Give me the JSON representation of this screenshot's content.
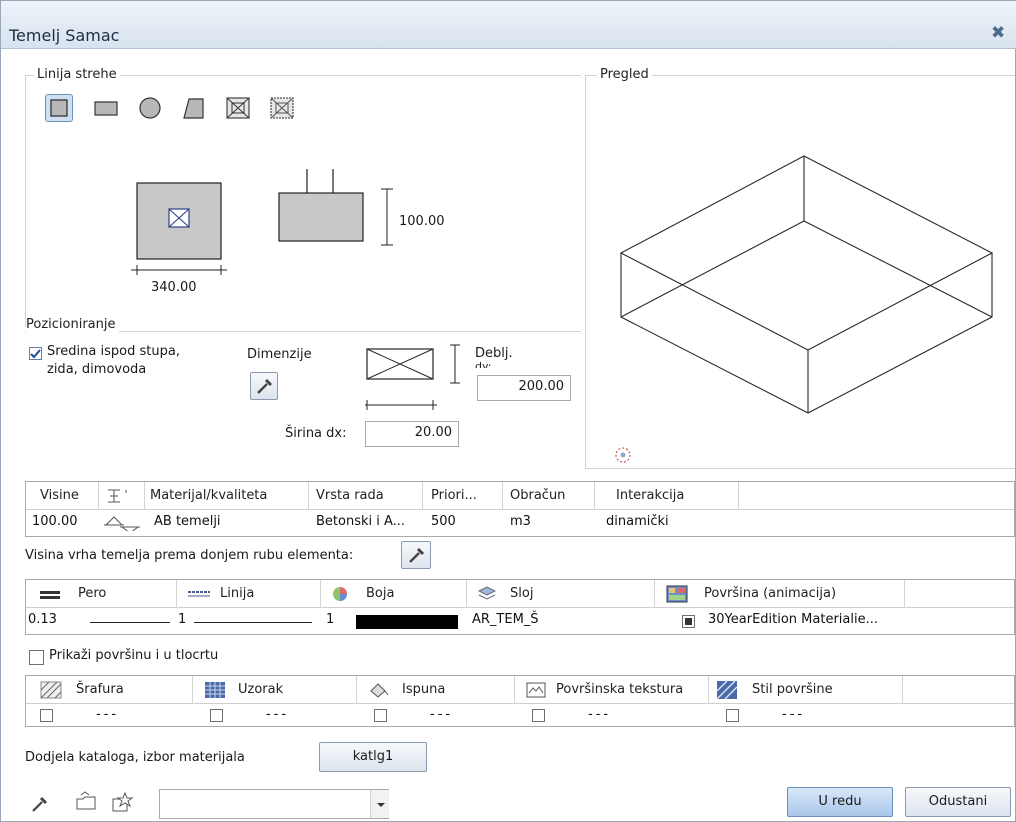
{
  "window": {
    "title": "Temelj Samac",
    "close_glyph": "✖"
  },
  "roof_line": {
    "group_label": "Linija strehe",
    "shapes": [
      "square-shape-icon",
      "rectangle-shape-icon",
      "circle-shape-icon",
      "trapezoid-shape-icon",
      "box-cross-shape-icon",
      "box-cross-dotted-shape-icon"
    ],
    "width_dim": "340.00",
    "height_dim": "100.00"
  },
  "preview": {
    "group_label": "Pregled"
  },
  "positioning": {
    "group_label": "Pozicioniranje",
    "center_checkbox_line1": "Sredina ispod stupa,",
    "center_checkbox_line2": "zida, dimovoda",
    "center_checked": true,
    "dimensions_label": "Dimenzije",
    "thickness_label_line1": "Deblj.",
    "thickness_label_line2": "dy:",
    "thickness_value": "200.00",
    "width_label": "Širina dx:",
    "width_value": "20.00"
  },
  "heights_table": {
    "headers": [
      "Visine",
      "",
      "Materijal/kvaliteta",
      "Vrsta rada",
      "Priori...",
      "Obračun",
      "Interakcija"
    ],
    "row": {
      "visine": "100.00",
      "material": "AB temelji",
      "work_type": "Betonski i A...",
      "priority": "500",
      "calc": "m3",
      "interaction": "dinamički"
    }
  },
  "top_label": "Visina vrha temelja prema donjem rubu elementa:",
  "format_table": {
    "headers": [
      "Pero",
      "Linija",
      "Boja",
      "Sloj",
      "Površina (animacija)"
    ],
    "row": {
      "pen": "0.13",
      "line": "1",
      "color": "1",
      "color_hex": "#000000",
      "layer": "AR_TEM_Š",
      "surface": "30YearEdition Materialie...",
      "surface_checked": true
    }
  },
  "show_surface_label": "Prikaži površinu i u tlocrtu",
  "fill_table": {
    "headers": [
      "Šrafura",
      "Uzorak",
      "Ispuna",
      "Površinska tekstura",
      "Stil površine"
    ],
    "values": [
      "---",
      "---",
      "---",
      "---",
      "---"
    ]
  },
  "catalog": {
    "label": "Dodjela kataloga, izbor materijala",
    "button": "katlg1"
  },
  "footer": {
    "combo_value": "",
    "ok": "U redu",
    "cancel": "Odustani"
  },
  "colors": {
    "accent": "#bcd3ef",
    "title_bg": "#dfe8f2"
  }
}
